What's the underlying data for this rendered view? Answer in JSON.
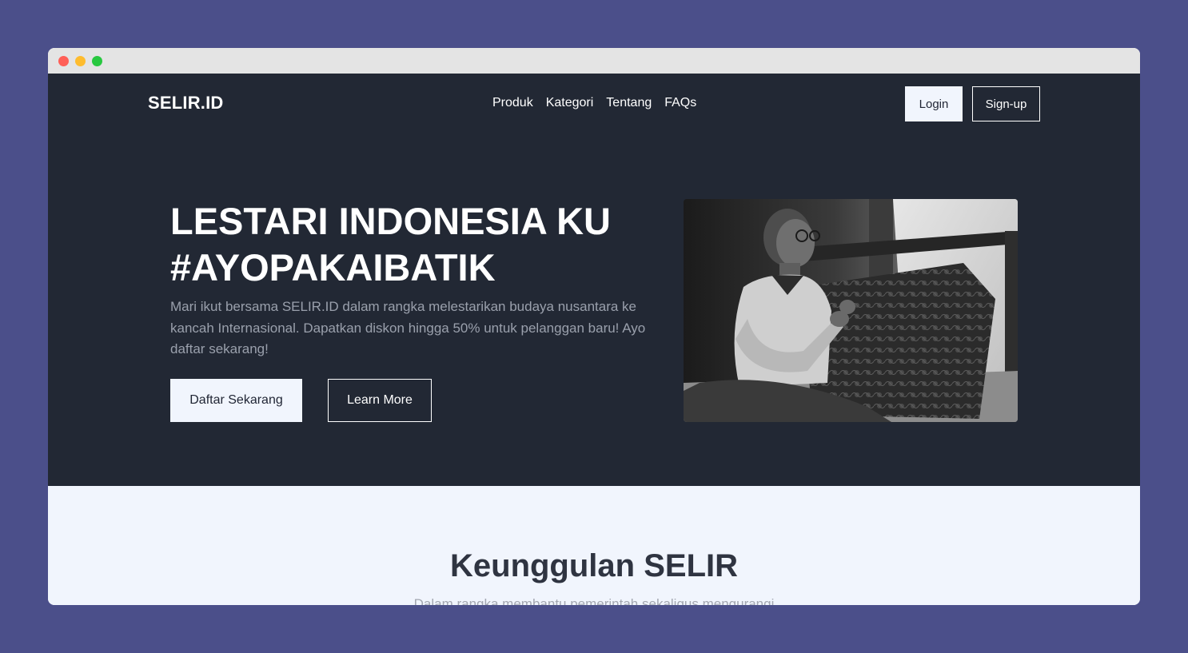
{
  "window": {
    "controls": [
      "close",
      "minimize",
      "maximize"
    ],
    "colors": {
      "close": "#ff5f57",
      "minimize": "#febc2e",
      "maximize": "#28c840"
    }
  },
  "navbar": {
    "brand": "SELIR.ID",
    "links": [
      "Produk",
      "Kategori",
      "Tentang",
      "FAQs"
    ],
    "login_label": "Login",
    "signup_label": "Sign-up"
  },
  "hero": {
    "title_line1": "LESTARI INDONESIA KU",
    "title_line2": "#AYOPAKAIBATIK",
    "description": "Mari ikut bersama SELIR.ID dalam rangka melestarikan budaya nusantara ke kancah Internasional. Dapatkan diskon hingga 50% untuk pelanggan baru! Ayo daftar sekarang!",
    "primary_button": "Daftar Sekarang",
    "secondary_button": "Learn More",
    "image": "batik-artisan-photo"
  },
  "features": {
    "title": "Keunggulan SELIR",
    "subtitle": "Dalam rangka membantu pemerintah sekaligus mengurangi"
  },
  "colors": {
    "page_background": "#4b4f8a",
    "hero_background": "#222834",
    "light_background": "#f1f5fd",
    "muted_text": "#9aa0ac"
  }
}
